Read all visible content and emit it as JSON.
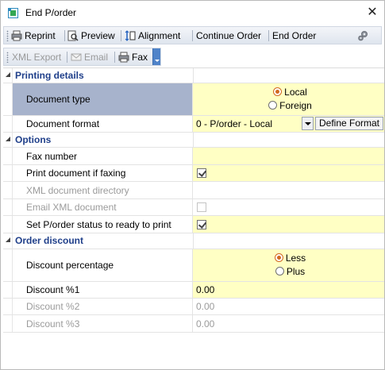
{
  "window": {
    "title": "End P/order",
    "close_glyph": "✕"
  },
  "toolbar": {
    "reprint": "Reprint",
    "preview": "Preview",
    "alignment": "Alignment",
    "continue_order": "Continue Order",
    "end_order": "End Order"
  },
  "toolbar2": {
    "xml_export": "XML Export",
    "email": "Email",
    "fax": "Fax"
  },
  "sections": {
    "printing": {
      "title": "Printing details",
      "document_type": {
        "label": "Document type",
        "options": [
          "Local",
          "Foreign"
        ],
        "selected": "Local"
      },
      "document_format": {
        "label": "Document format",
        "value": "0 - P/order - Local",
        "button": "Define Format"
      }
    },
    "options": {
      "title": "Options",
      "fax_number": {
        "label": "Fax number",
        "value": ""
      },
      "print_if_faxing": {
        "label": "Print document if faxing",
        "checked": true
      },
      "xml_dir": {
        "label": "XML document directory",
        "value": ""
      },
      "email_xml": {
        "label": "Email XML document",
        "checked": false
      },
      "set_status": {
        "label": "Set P/order status to ready to print",
        "checked": true
      }
    },
    "discount": {
      "title": "Order discount",
      "discount_percentage": {
        "label": "Discount percentage",
        "options": [
          "Less",
          "Plus"
        ],
        "selected": "Less"
      },
      "discount1": {
        "label": "Discount %1",
        "value": "0.00"
      },
      "discount2": {
        "label": "Discount %2",
        "value": "0.00"
      },
      "discount3": {
        "label": "Discount %3",
        "value": "0.00"
      }
    }
  },
  "colors": {
    "category_text": "#1f3f8a",
    "selected_row": "#a7b3cc",
    "editable_value": "#ffffc4",
    "radio_selected": "#d2691e"
  }
}
